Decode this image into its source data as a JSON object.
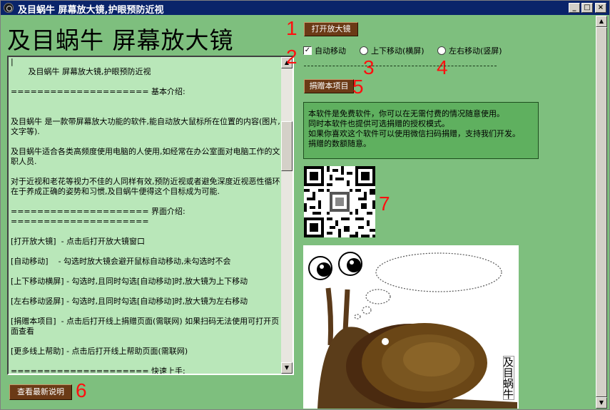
{
  "window": {
    "title": "及目蜗牛 屏幕放大镜,护眼预防近视",
    "minimize": "_",
    "maximize": "□",
    "close": "×"
  },
  "app_title": "及目蜗牛  屏幕放大镜",
  "buttons": {
    "open_magnifier": "打开放大镜",
    "donate": "捐赠本项目",
    "view_latest": "查看最新说明"
  },
  "options": {
    "auto_move": {
      "label": "自动移动",
      "checked": true
    },
    "vertical_move": {
      "label": "上下移动(横屏)",
      "checked": false
    },
    "horizontal_move": {
      "label": "左右移动(竖屏)",
      "checked": false
    }
  },
  "annotations": [
    "1",
    "2",
    "3",
    "4",
    "5",
    "6",
    "7"
  ],
  "description_text": "|\n       及目蜗牛 屏幕放大镜,护眼预防近视\n\n===================== 基本介绍:\n\n\n及目蜗牛 是一款带屏幕放大功能的软件,能自动放大鼠标所在位置的内容(图片,文字等).\n\n及目蜗牛适合各类高频度使用电脑的人使用,如经常在办公室面对电脑工作的文职人员.\n\n对于近视和老花等视力不佳的人同样有效,预防近视或者避免深度近视恶性循环在于养成正确的姿势和习惯,及目蜗牛便得这个目标成为可能.\n\n===================== 界面介绍:\n=====================\n\n[打开放大镜]  - 点击后打开放大镜窗口\n\n[自动移动]    - 勾选时放大镜会避开鼠标自动移动,未勾选时不会\n\n[上下移动横屏] - 勾选时,且同时勾选[自动移动]时,放大镜为上下移动\n\n[左右移动竖屏] - 勾选时,且同时勾选[自动移动]时,放大镜为左右移动\n\n[捐赠本项目]  - 点击后打开线上捐赠页面(需联网) 如果扫码无法使用可打开页面查看\n\n[更多线上帮助] - 点击后打开线上帮助页面(需联网)\n\n===================== 快速上手:\n=====================",
  "info_lines": [
    "本软件是免费软件，你可以在无需付费的情况随意使用。",
    "同时本软件也提供可选捐赠的授权模式。",
    "如果你喜欢这个软件可以使用微信扫码捐赠，支持我们开发。",
    "捐赠的数额随意。"
  ],
  "snail_label": "及目蜗牛",
  "colors": {
    "titlebar": "#0a246a",
    "window_bg": "#7ebf7e",
    "textarea_bg": "#b9e7b9",
    "button_bg": "#6b3a16",
    "annotation": "#ff1010",
    "infobox_bg": "#5fb05f"
  }
}
